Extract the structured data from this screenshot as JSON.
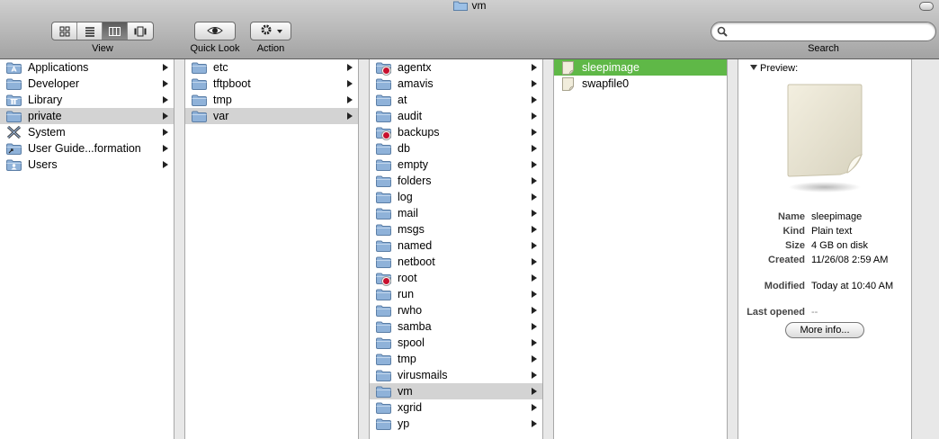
{
  "window": {
    "title": "vm"
  },
  "toolbar": {
    "view_label": "View",
    "quicklook_label": "Quick Look",
    "action_label": "Action",
    "search_label": "Search",
    "search_value": "",
    "view_modes": [
      "icon-view-icon",
      "list-view-icon",
      "column-view-icon",
      "coverflow-view-icon"
    ],
    "active_view": "column-view-icon"
  },
  "col1": [
    {
      "label": "Applications",
      "icon": "applications-folder-icon",
      "arrow": true
    },
    {
      "label": "Developer",
      "icon": "folder-icon",
      "arrow": true
    },
    {
      "label": "Library",
      "icon": "library-folder-icon",
      "arrow": true
    },
    {
      "label": "private",
      "icon": "folder-icon",
      "arrow": true,
      "selected": true
    },
    {
      "label": "System",
      "icon": "system-folder-icon",
      "arrow": true
    },
    {
      "label": "User Guide...formation",
      "icon": "alias-folder-icon",
      "arrow": true
    },
    {
      "label": "Users",
      "icon": "users-folder-icon",
      "arrow": true
    }
  ],
  "col2": [
    {
      "label": "etc",
      "icon": "folder-icon",
      "arrow": true
    },
    {
      "label": "tftpboot",
      "icon": "folder-icon",
      "arrow": true
    },
    {
      "label": "tmp",
      "icon": "folder-icon",
      "arrow": true
    },
    {
      "label": "var",
      "icon": "folder-icon",
      "arrow": true,
      "selected": true
    }
  ],
  "col3": [
    {
      "label": "agentx",
      "icon": "locked-folder-icon",
      "arrow": true
    },
    {
      "label": "amavis",
      "icon": "folder-icon",
      "arrow": true
    },
    {
      "label": "at",
      "icon": "folder-icon",
      "arrow": true
    },
    {
      "label": "audit",
      "icon": "folder-icon",
      "arrow": true
    },
    {
      "label": "backups",
      "icon": "locked-folder-icon",
      "arrow": true
    },
    {
      "label": "db",
      "icon": "folder-icon",
      "arrow": true
    },
    {
      "label": "empty",
      "icon": "folder-icon",
      "arrow": true
    },
    {
      "label": "folders",
      "icon": "folder-icon",
      "arrow": true
    },
    {
      "label": "log",
      "icon": "folder-icon",
      "arrow": true
    },
    {
      "label": "mail",
      "icon": "folder-icon",
      "arrow": true
    },
    {
      "label": "msgs",
      "icon": "folder-icon",
      "arrow": true
    },
    {
      "label": "named",
      "icon": "folder-icon",
      "arrow": true
    },
    {
      "label": "netboot",
      "icon": "folder-icon",
      "arrow": true
    },
    {
      "label": "root",
      "icon": "locked-folder-icon",
      "arrow": true
    },
    {
      "label": "run",
      "icon": "folder-icon",
      "arrow": true
    },
    {
      "label": "rwho",
      "icon": "folder-icon",
      "arrow": true
    },
    {
      "label": "samba",
      "icon": "folder-icon",
      "arrow": true
    },
    {
      "label": "spool",
      "icon": "folder-icon",
      "arrow": true
    },
    {
      "label": "tmp",
      "icon": "folder-icon",
      "arrow": true
    },
    {
      "label": "virusmails",
      "icon": "folder-icon",
      "arrow": true
    },
    {
      "label": "vm",
      "icon": "folder-icon",
      "arrow": true,
      "selected": true
    },
    {
      "label": "xgrid",
      "icon": "folder-icon",
      "arrow": true
    },
    {
      "label": "yp",
      "icon": "folder-icon",
      "arrow": true
    }
  ],
  "col4": [
    {
      "label": "sleepimage",
      "icon": "document-icon",
      "highlighted": true
    },
    {
      "label": "swapfile0",
      "icon": "document-icon"
    }
  ],
  "preview": {
    "header": "Preview:",
    "name_key": "Name",
    "name": "sleepimage",
    "kind_key": "Kind",
    "kind": "Plain text",
    "size_key": "Size",
    "size": "4 GB on disk",
    "created_key": "Created",
    "created": "11/26/08 2:59 AM",
    "modified_key": "Modified",
    "modified": "Today at 10:40 AM",
    "lastopened_key": "Last opened",
    "lastopened": "--",
    "more_info": "More info..."
  },
  "colors": {
    "selection_gray": "#d3d3d3",
    "highlight_green": "#5fb847",
    "folder_blue": "#8fb2d9"
  }
}
